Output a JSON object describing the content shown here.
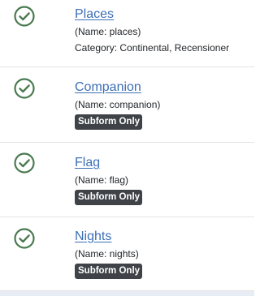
{
  "fields": [
    {
      "title": "Places",
      "machine_name": "(Name: places)",
      "category": "Category: Continental, Recensioner",
      "status_icon": "check-circle-icon"
    },
    {
      "title": "Companion",
      "machine_name": "(Name: companion)",
      "badge": "Subform Only",
      "status_icon": "check-circle-icon"
    },
    {
      "title": "Flag",
      "machine_name": "(Name: flag)",
      "badge": "Subform Only",
      "status_icon": "check-circle-icon"
    },
    {
      "title": "Nights",
      "machine_name": "(Name: nights)",
      "badge": "Subform Only",
      "status_icon": "check-circle-icon"
    }
  ],
  "colors": {
    "check": "#4a7a50",
    "link": "#3c6fb6",
    "badge_bg": "#3f4348",
    "divider": "#e3e3e3",
    "bottom_bar": "#e8edf5"
  }
}
